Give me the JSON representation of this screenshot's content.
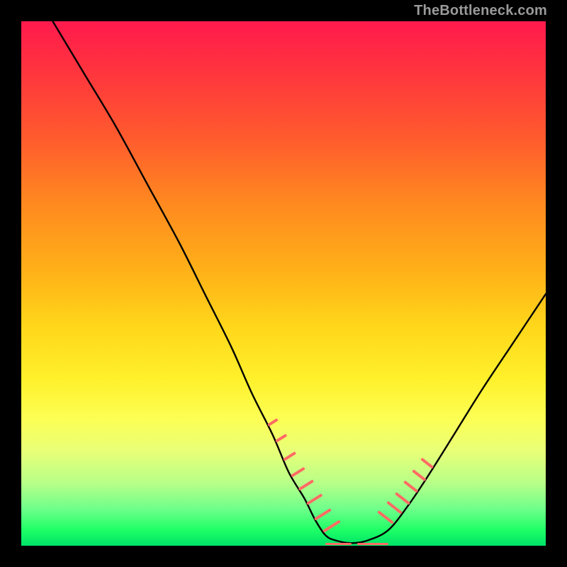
{
  "watermark": "TheBottleneck.com",
  "chart_data": {
    "type": "line",
    "title": "",
    "xlabel": "",
    "ylabel": "",
    "xlim": [
      0,
      100
    ],
    "ylim": [
      0,
      100
    ],
    "series": [
      {
        "name": "curve",
        "x": [
          6,
          12,
          18,
          24,
          30,
          35,
          40,
          44,
          48,
          51,
          54,
          56,
          58,
          60,
          63,
          66,
          70,
          74,
          78,
          83,
          88,
          94,
          100
        ],
        "y": [
          100,
          90,
          80,
          69,
          58,
          48,
          38,
          29,
          21,
          14,
          9,
          5,
          2,
          1,
          0.5,
          1,
          3,
          8,
          14,
          22,
          30,
          39,
          48
        ]
      }
    ],
    "markers": {
      "bottom_ridge_segments": [
        {
          "x_start": 58,
          "x_end": 63
        },
        {
          "x_start": 64,
          "x_end": 70
        }
      ],
      "left_ticks_x": [
        47,
        48.5,
        50,
        51.5,
        53,
        54.5,
        56,
        57.5
      ],
      "right_ticks_x": [
        71,
        72.5,
        74,
        75.5,
        77,
        78.5
      ]
    },
    "background_gradient": {
      "stops": [
        {
          "pos": 0,
          "color": "#ff1a4d"
        },
        {
          "pos": 22,
          "color": "#ff5a2e"
        },
        {
          "pos": 48,
          "color": "#ffb218"
        },
        {
          "pos": 68,
          "color": "#fff02a"
        },
        {
          "pos": 88,
          "color": "#b8ff88"
        },
        {
          "pos": 100,
          "color": "#00e268"
        }
      ]
    }
  }
}
